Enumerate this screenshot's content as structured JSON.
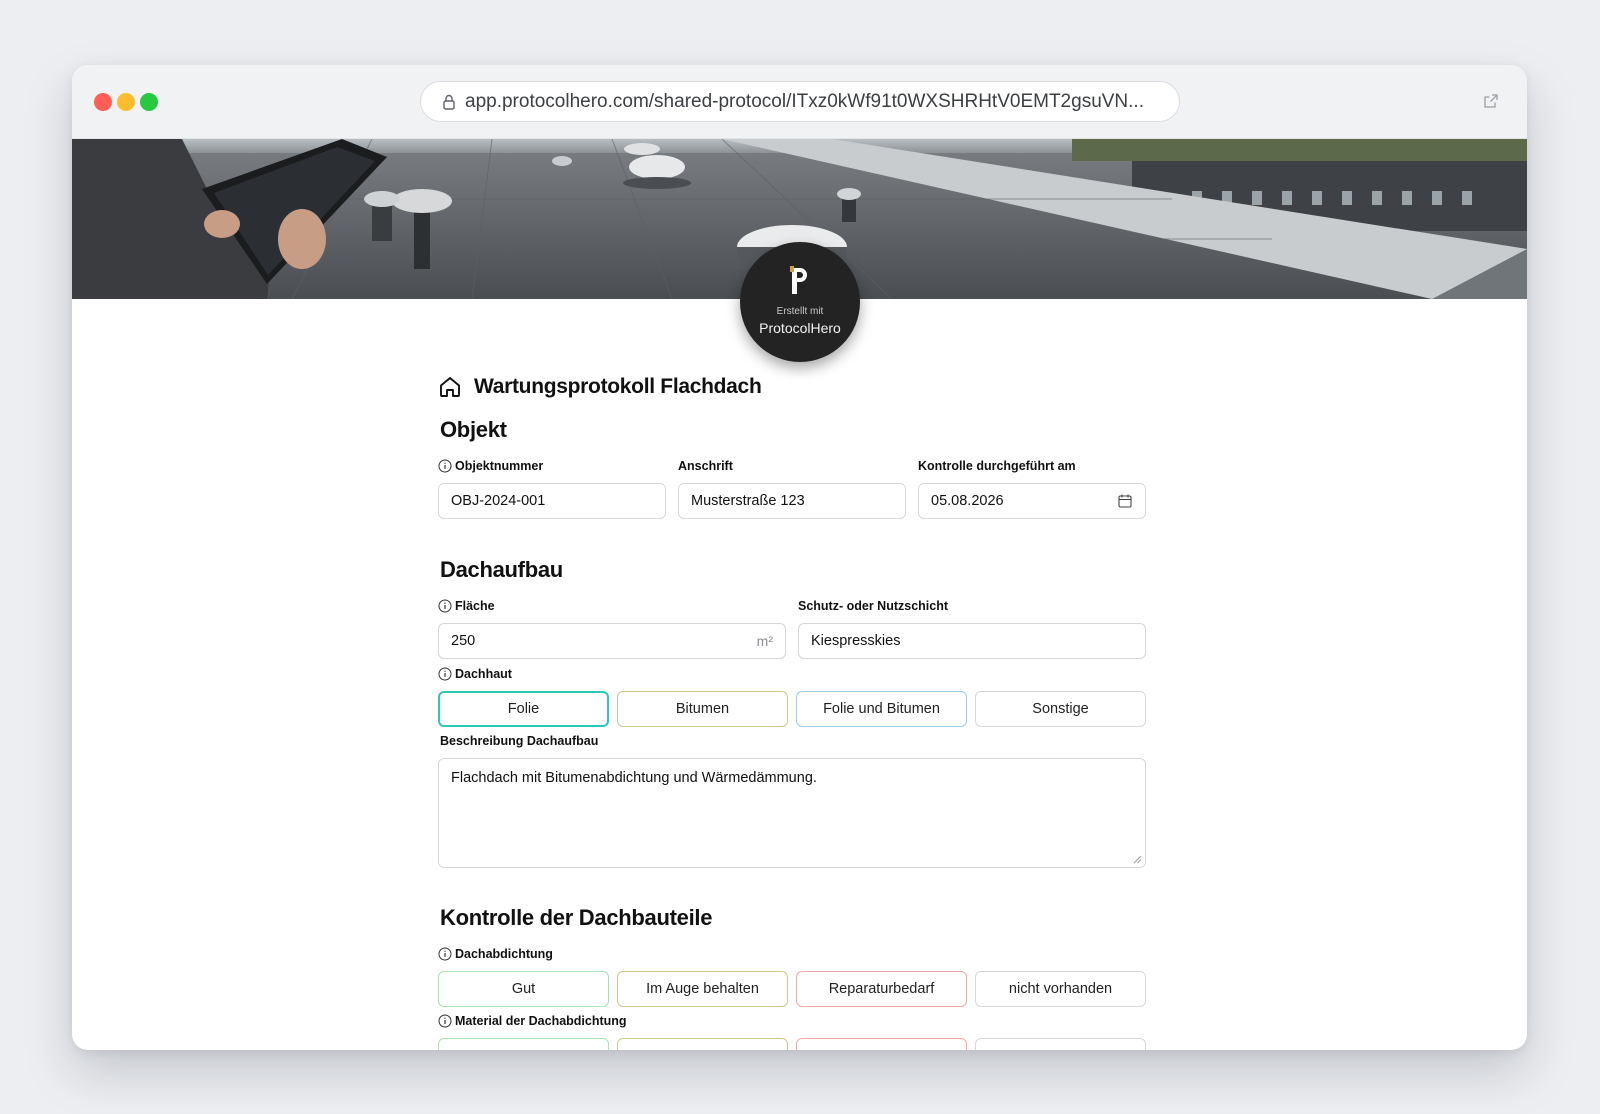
{
  "browser": {
    "url": "app.protocolhero.com/shared-protocol/ITxz0kWf91t0WXSHRHtV0EMT2gsuVN..."
  },
  "badge": {
    "small": "Erstellt mit",
    "brand": "ProtocolHero"
  },
  "page_title": "Wartungsprotokoll Flachdach",
  "objekt": {
    "heading": "Objekt",
    "objektnummer_label": "Objektnummer",
    "objektnummer_value": "OBJ-2024-001",
    "anschrift_label": "Anschrift",
    "anschrift_value": "Musterstraße 123",
    "kontrolle_label": "Kontrolle durchgeführt am",
    "kontrolle_value": "05.08.2026"
  },
  "dachaufbau": {
    "heading": "Dachaufbau",
    "flaeche_label": "Fläche",
    "flaeche_value": "250",
    "flaeche_unit": "m²",
    "schutz_label": "Schutz- oder Nutzschicht",
    "schutz_value": "Kiespresskies",
    "dachhaut_label": "Dachhaut",
    "dachhaut_options": [
      "Folie",
      "Bitumen",
      "Folie und Bitumen",
      "Sonstige"
    ],
    "beschreibung_label": "Beschreibung Dachaufbau",
    "beschreibung_value": "Flachdach mit Bitumenabdichtung und Wärmedämmung."
  },
  "kontrolle": {
    "heading": "Kontrolle der Dachbauteile",
    "dachabdichtung_label": "Dachabdichtung",
    "dachabdichtung_options": [
      "Gut",
      "Im Auge behalten",
      "Reparaturbedarf",
      "nicht vorhanden"
    ],
    "material_label": "Material der Dachabdichtung"
  },
  "colors": {
    "teal": "#2ec7b6",
    "olive": "#cdc98a",
    "blue": "#9fcbe6",
    "gray": "#d6d8dc",
    "green": "#a7e3b5",
    "red": "#f2a9a9"
  }
}
